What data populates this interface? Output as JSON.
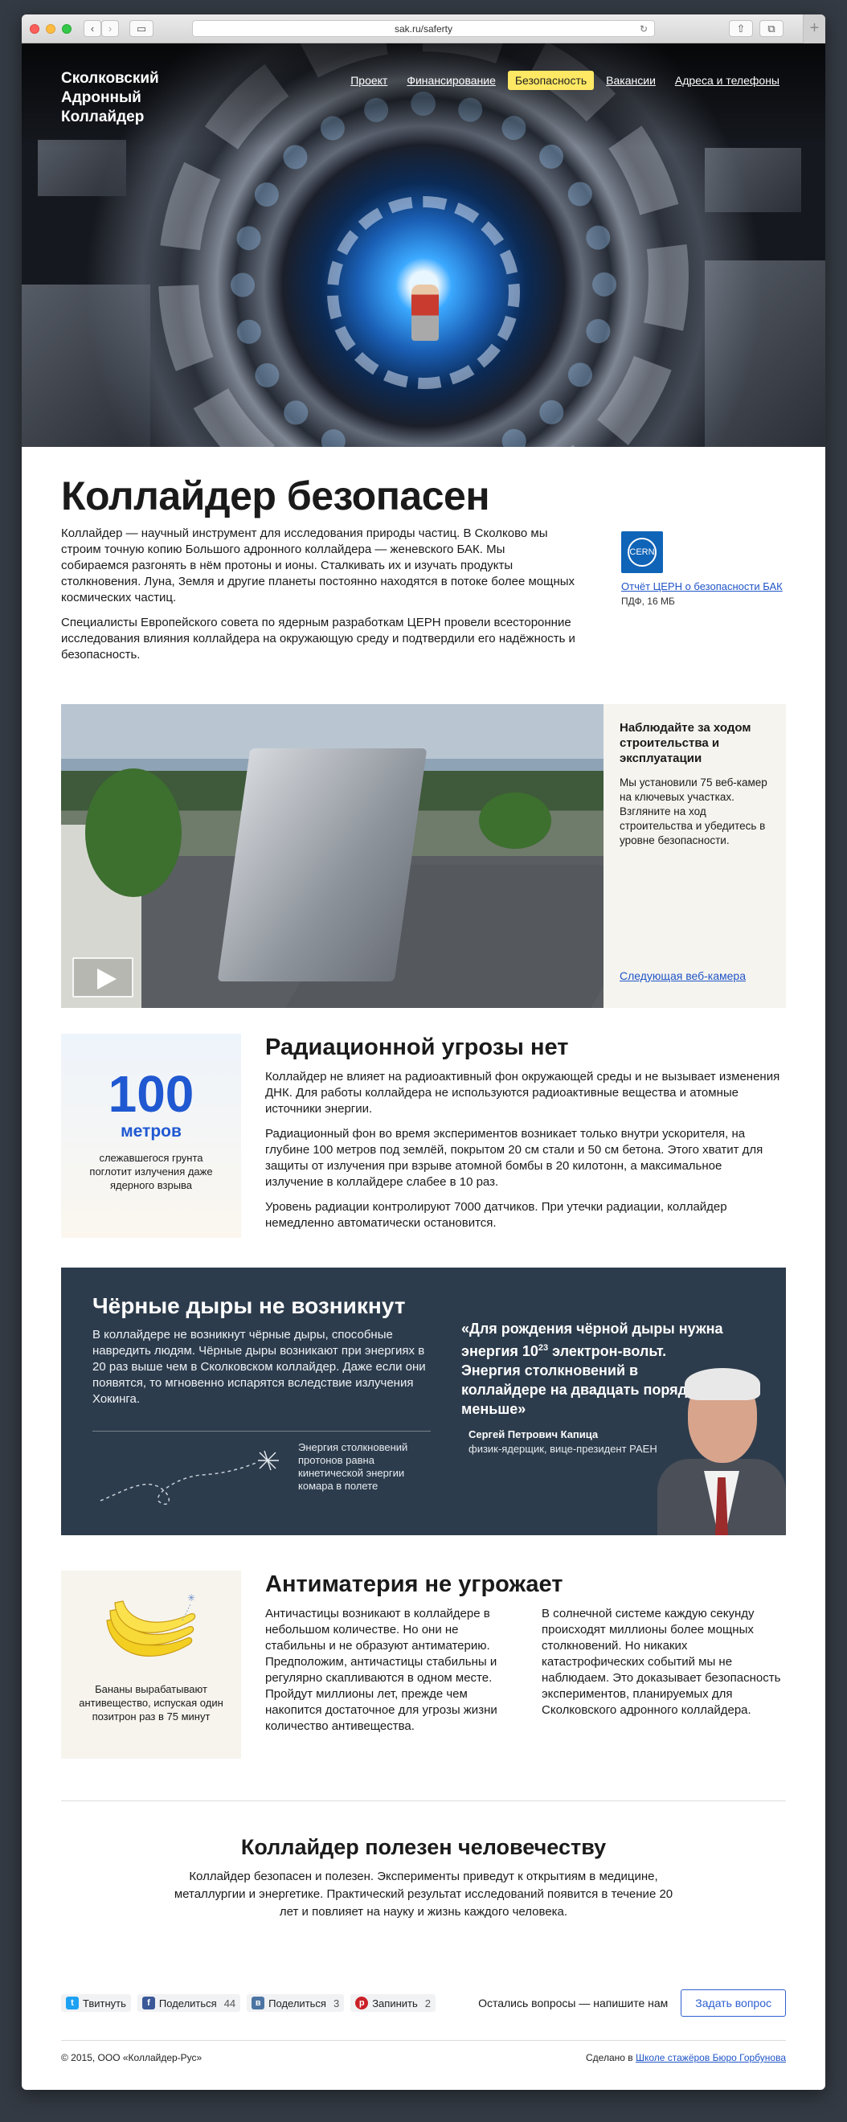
{
  "browser": {
    "url": "sak.ru/saferty"
  },
  "header": {
    "logo": "Сколковский Адронный Коллайдер",
    "nav": [
      "Проект",
      "Финансирование",
      "Безопасность",
      "Вакансии",
      "Адреса и телефоны"
    ],
    "active_nav": "Безопасность"
  },
  "intro": {
    "title": "Коллайдер безопасен",
    "p1": "Коллайдер — научный инструмент для исследования природы частиц. В Сколково мы строим точную копию Большого адронного коллайдера — женевского БАК. Мы собираемся разгонять в нём протоны и ионы. Сталкивать их и изучать продукты столкновения. Луна, Земля и другие планеты постоянно находятся в потоке более мощных космических частиц.",
    "p2": "Специалисты Европейского совета по ядерным разработкам ЦЕРН провели всесторонние исследования влияния коллайдера на окружающую среду и подтвердили его надёжность и безопасность.",
    "report_logo": "CERN",
    "report_link": "Отчёт ЦЕРН о безопасности БАК",
    "report_meta": "ПДФ, 16 МБ"
  },
  "webcam": {
    "title": "Наблюдайте за ходом строительства и эксплуатации",
    "text": "Мы установили 75 веб-камер на ключевых участках. Взгляните на ход строительства и убедитесь в уровне безопасности.",
    "next_link": "Следующая веб-камера"
  },
  "radiation": {
    "stat_number": "100",
    "stat_unit": "метров",
    "stat_caption": "слежавшегося грунта поглотит излучения даже ядерного взрыва",
    "title": "Радиационной угрозы нет",
    "p1": "Коллайдер не влияет на радиоактивный фон окружающей среды и не вызывает изменения ДНК. Для работы коллайдера не используются радиоактивные вещества и атомные источники энергии.",
    "p2": "Радиационный фон во время экспериментов возникает только внутри ускорителя, на глубине 100 метров под землёй, покрытом 20 см стали и 50 см бетона. Этого хватит для защиты от излучения при взрыве атомной бомбы в 20 килотонн, а максимальное излучение в коллайдере слабее в 10 раз.",
    "p3": "Уровень радиации контролируют 7000 датчиков. При утечки радиации, коллайдер немедленно автоматически остановится."
  },
  "blackholes": {
    "title": "Чёрные дыры не возникнут",
    "text": "В коллайдере не возникнут чёрные дыры, способные навредить людям. Чёрные дыры возникают при энергиях в 20 раз выше чем в Сколковском коллайдер. Даже если они появятся, то мгновенно испарятся вследствие излучения Хокинга.",
    "note": "Энергия столкновений протонов равна кинетической энергии комара в полете",
    "quote_a": "«Для рождения чёрной дыры нужна энергия 10",
    "quote_sup": "23",
    "quote_b": " электрон-вольт. Энергия столкновений в коллайдере на двадцать порядков меньше»",
    "author": "Сергей Петрович Капица",
    "role": "физик-ядерщик, вице-президент РАЕН"
  },
  "antimatter": {
    "banana_caption": "Бананы вырабатывают антивещество, испуская один позитрон раз в 75 минут",
    "title": "Антиматерия не угрожает",
    "col1": "Античастицы возникают в коллайдере в небольшом количестве. Но они не стабильны и не образуют антиматерию. Предположим, античастицы стабильны и регулярно скапливаются в одном месте. Пройдут миллионы лет, прежде чем накопится достаточное для угрозы жизни количество антивещества.",
    "col2": "В солнечной системе каждую секунду происходят миллионы более мощных столкновений. Но никаких катастрофических событий мы не наблюдаем. Это доказывает безопасность экспериментов, планируемых для Сколковского адронного коллайдера."
  },
  "useful": {
    "title": "Коллайдер полезен человечеству",
    "text": "Коллайдер безопасен и полезен. Эксперименты приведут к открытиям в медицине, металлургии и энергетике. Практический результат исследований появится в течение 20 лет и повлияет на науку и жизнь каждого человека."
  },
  "share": {
    "twitter": "Твитнуть",
    "facebook": "Поделиться",
    "facebook_count": "44",
    "vk": "Поделиться",
    "vk_count": "3",
    "pinterest": "Запинить",
    "pinterest_count": "2",
    "ask_text": "Остались вопросы — напишите нам",
    "ask_button": "Задать вопрос"
  },
  "footer": {
    "copyright": "© 2015, ООО «Коллайдер-Рус»",
    "made_by_prefix": "Сделано в ",
    "made_by_link": "Школе стажёров Бюро Горбунова"
  },
  "colors": {
    "accent": "#1f58d1",
    "link": "#2055c7",
    "nav_active": "#ffe863",
    "dark_panel": "#2d3c4c"
  }
}
